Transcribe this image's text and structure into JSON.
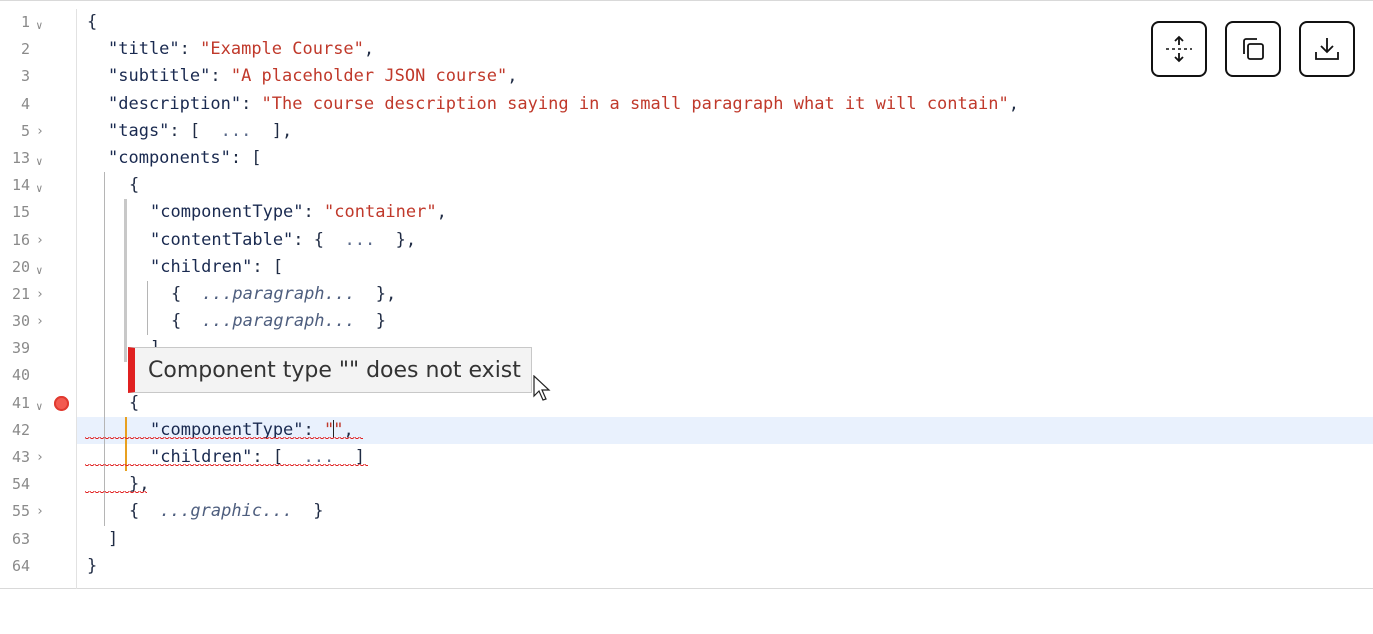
{
  "toolbar": {
    "buttons": [
      {
        "name": "expand-all-button",
        "icon": "expand-vertical-icon"
      },
      {
        "name": "copy-button",
        "icon": "copy-icon"
      },
      {
        "name": "download-button",
        "icon": "download-icon"
      }
    ]
  },
  "tooltip": {
    "message": "Component type \"\" does not exist"
  },
  "gutter": [
    {
      "n": "1",
      "fold": "open"
    },
    {
      "n": "2",
      "fold": ""
    },
    {
      "n": "3",
      "fold": ""
    },
    {
      "n": "4",
      "fold": ""
    },
    {
      "n": "5",
      "fold": "closed"
    },
    {
      "n": "13",
      "fold": "open"
    },
    {
      "n": "14",
      "fold": "open"
    },
    {
      "n": "15",
      "fold": ""
    },
    {
      "n": "16",
      "fold": "closed"
    },
    {
      "n": "20",
      "fold": "open"
    },
    {
      "n": "21",
      "fold": "closed"
    },
    {
      "n": "30",
      "fold": "closed"
    },
    {
      "n": "39",
      "fold": ""
    },
    {
      "n": "40",
      "fold": ""
    },
    {
      "n": "41",
      "fold": "open",
      "breakpoint": true
    },
    {
      "n": "42",
      "fold": ""
    },
    {
      "n": "43",
      "fold": "closed"
    },
    {
      "n": "54",
      "fold": ""
    },
    {
      "n": "55",
      "fold": "closed"
    },
    {
      "n": "63",
      "fold": ""
    },
    {
      "n": "64",
      "fold": ""
    }
  ],
  "code": {
    "l1": "{",
    "l2_key": "\"title\"",
    "l2_val": "\"Example Course\"",
    "l3_key": "\"subtitle\"",
    "l3_val": "\"A placeholder JSON course\"",
    "l4_key": "\"description\"",
    "l4_val": "\"The course description saying in a small paragraph what it will contain\"",
    "l5_key": "\"tags\"",
    "l5_fold": "...",
    "l13_key": "\"components\"",
    "l14": "{",
    "l15_key": "\"componentType\"",
    "l15_val": "\"container\"",
    "l16_key": "\"contentTable\"",
    "l16_fold": "...",
    "l20_key": "\"children\"",
    "l21_fold": "...paragraph...",
    "l30_fold": "...paragraph...",
    "l39": "]",
    "l41": "{",
    "l42_key": "\"componentType\"",
    "l42_val_open": "\"",
    "l42_val_close": "\"",
    "l43_key": "\"children\"",
    "l43_fold": "...",
    "l54": "},",
    "l55_fold": "...graphic...",
    "l63": "]",
    "l64": "}"
  }
}
